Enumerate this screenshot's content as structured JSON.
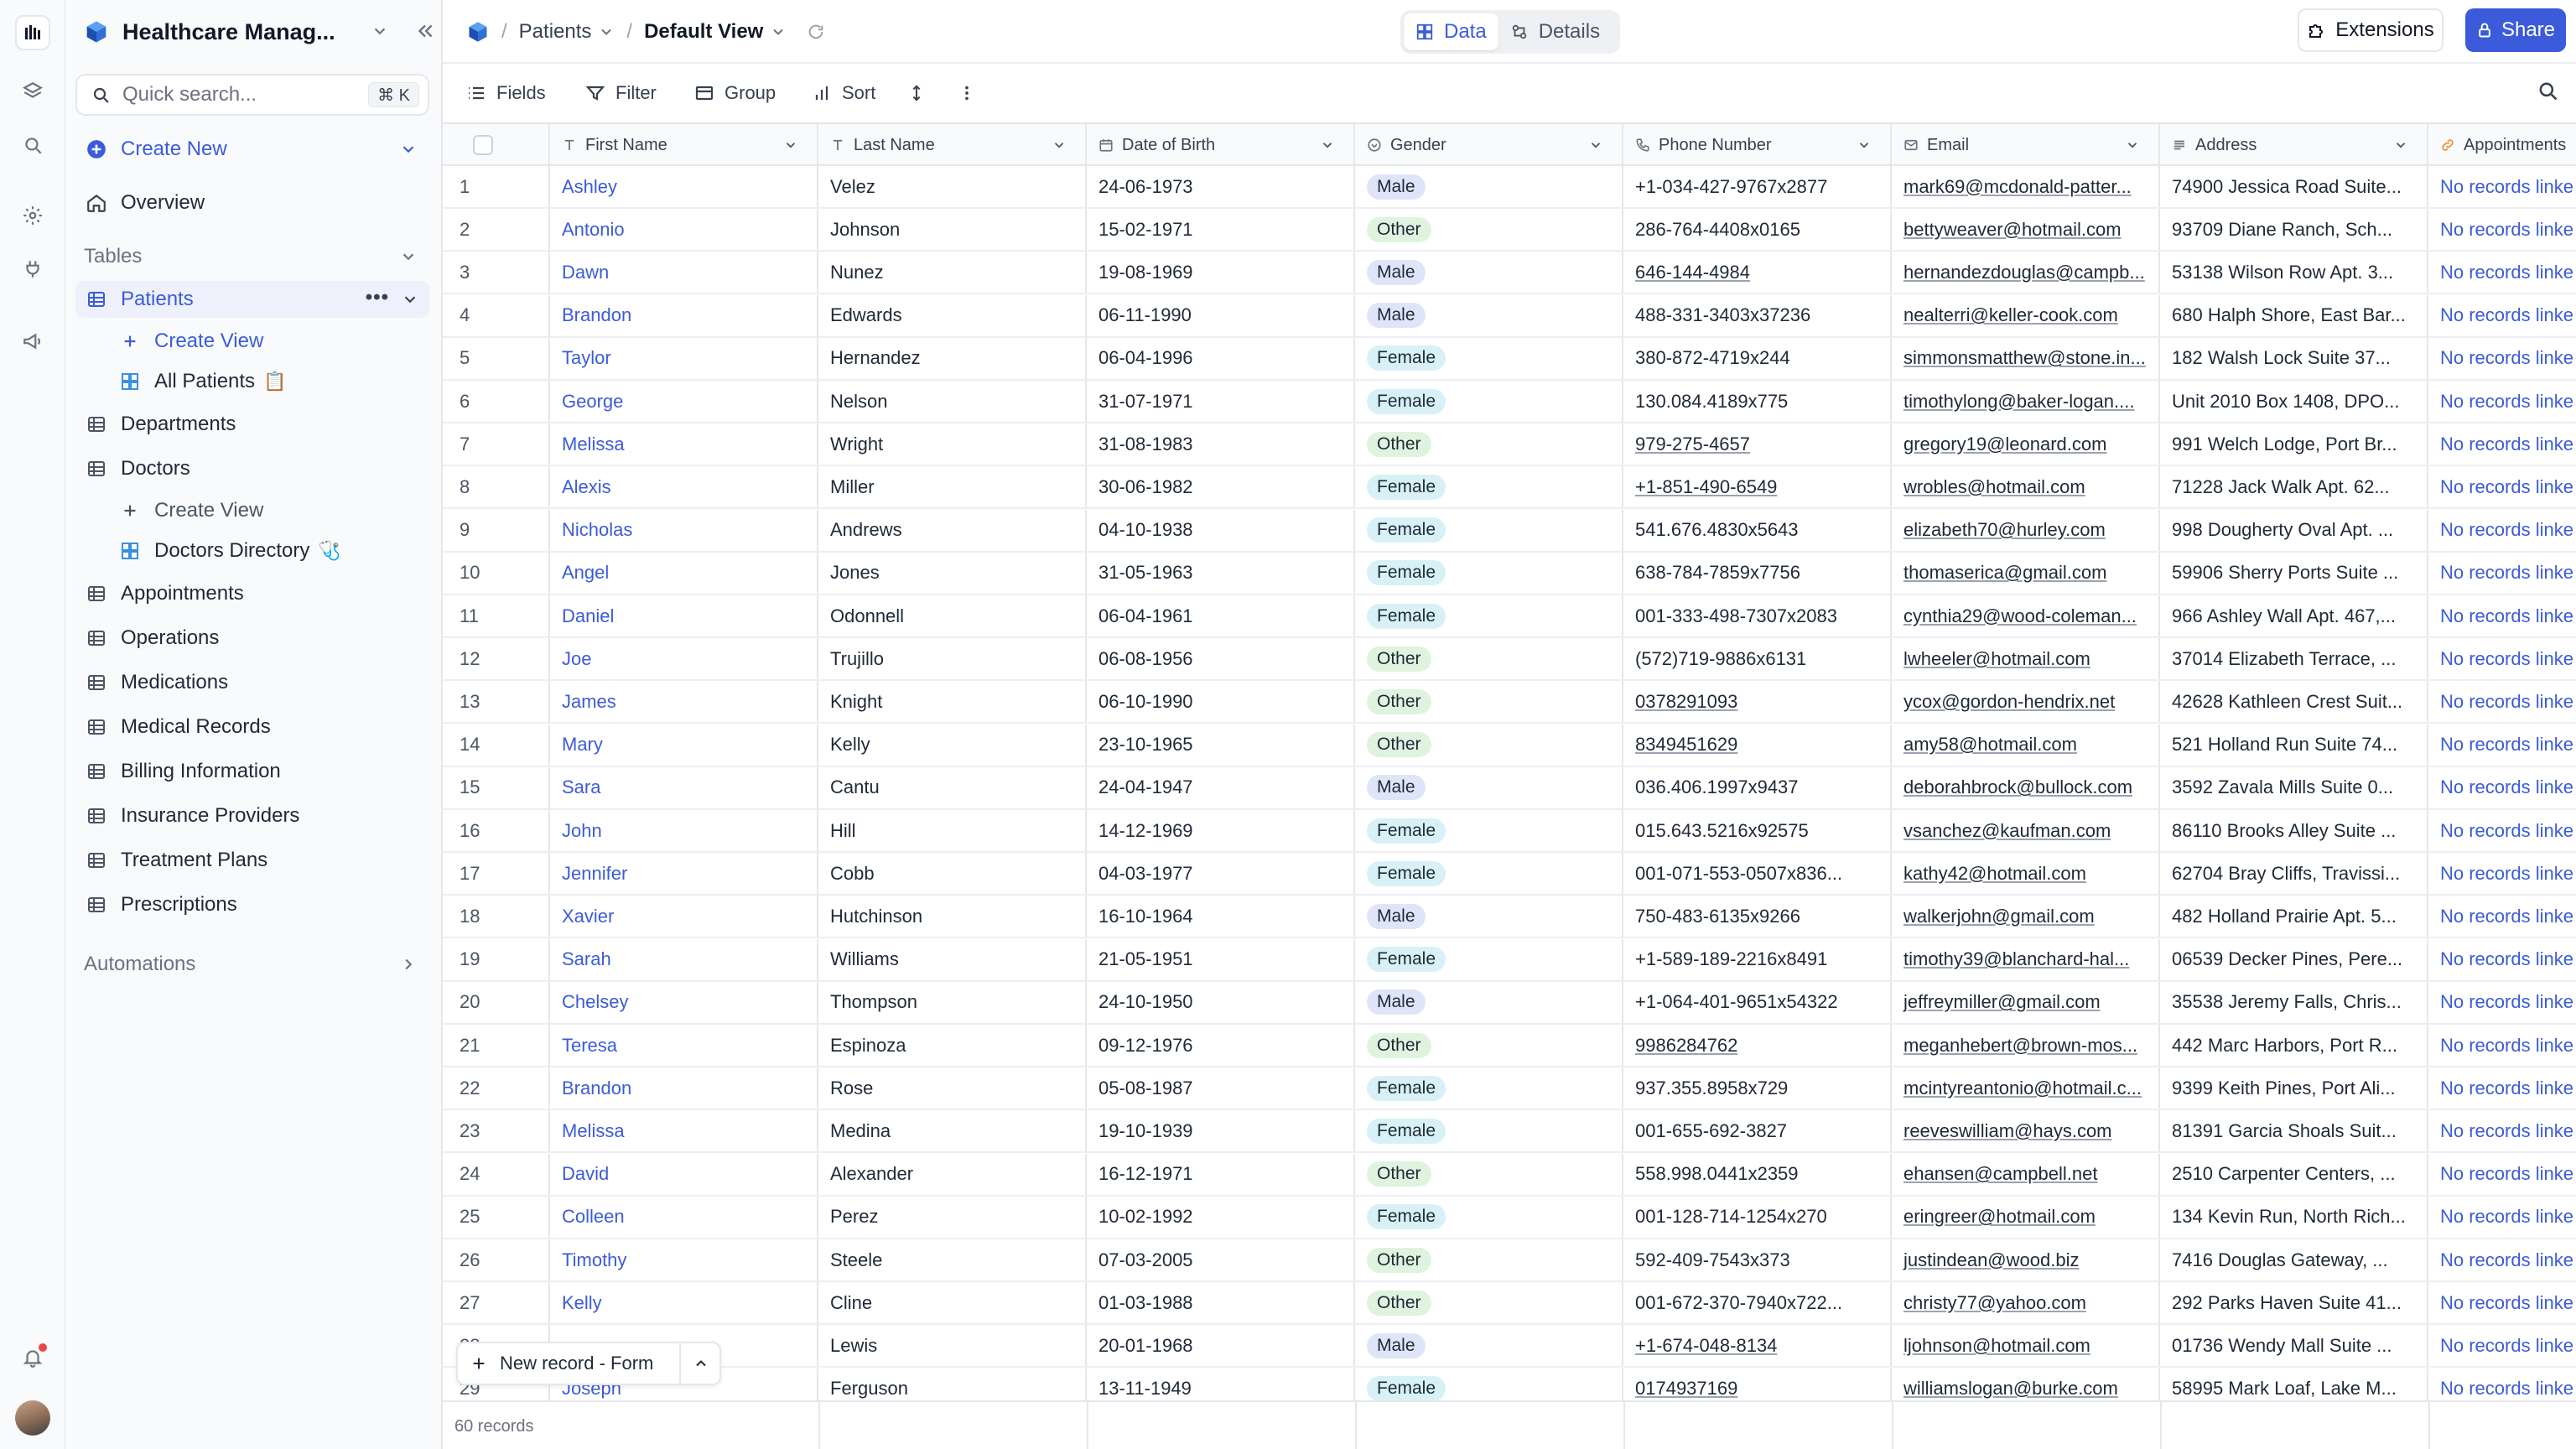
{
  "workspace": {
    "title": "Healthcare Manag..."
  },
  "search": {
    "placeholder": "Quick search...",
    "shortcut": "⌘ K"
  },
  "sidebar": {
    "create_new": "Create New",
    "overview": "Overview",
    "tables_label": "Tables",
    "automations_label": "Automations",
    "items": [
      {
        "label": "Patients",
        "active": true
      },
      {
        "label": "Create View",
        "kind": "create-view"
      },
      {
        "label": "All Patients",
        "kind": "view"
      },
      {
        "label": "Departments"
      },
      {
        "label": "Doctors"
      },
      {
        "label": "Create View",
        "kind": "create-view"
      },
      {
        "label": "Doctors Directory",
        "kind": "view"
      },
      {
        "label": "Appointments"
      },
      {
        "label": "Operations"
      },
      {
        "label": "Medications"
      },
      {
        "label": "Medical Records"
      },
      {
        "label": "Billing Information"
      },
      {
        "label": "Insurance Providers"
      },
      {
        "label": "Treatment Plans"
      },
      {
        "label": "Prescriptions"
      }
    ]
  },
  "topbar": {
    "crumb_table": "Patients",
    "crumb_view": "Default View",
    "tab_data": "Data",
    "tab_details": "Details",
    "extensions": "Extensions",
    "share": "Share"
  },
  "toolbar": {
    "fields": "Fields",
    "filter": "Filter",
    "group": "Group",
    "sort": "Sort"
  },
  "columns": [
    "First Name",
    "Last Name",
    "Date of Birth",
    "Gender",
    "Phone Number",
    "Email",
    "Address",
    "Appointments"
  ],
  "rows": [
    [
      "1",
      "Ashley",
      "Velez",
      "24-06-1973",
      "Male",
      "+1-034-427-9767x2877",
      "mark69@mcdonald-patter...",
      "74900 Jessica Road Suite...",
      "No records linke"
    ],
    [
      "2",
      "Antonio",
      "Johnson",
      "15-02-1971",
      "Other",
      "286-764-4408x0165",
      "bettyweaver@hotmail.com",
      "93709 Diane Ranch, Sch...",
      "No records linke"
    ],
    [
      "3",
      "Dawn",
      "Nunez",
      "19-08-1969",
      "Male",
      "646-144-4984",
      "hernandezdouglas@campb...",
      "53138 Wilson Row Apt. 3...",
      "No records linke"
    ],
    [
      "4",
      "Brandon",
      "Edwards",
      "06-11-1990",
      "Male",
      "488-331-3403x37236",
      "nealterri@keller-cook.com",
      "680 Halph Shore, East Bar...",
      "No records linke"
    ],
    [
      "5",
      "Taylor",
      "Hernandez",
      "06-04-1996",
      "Female",
      "380-872-4719x244",
      "simmonsmatthew@stone.in...",
      "182 Walsh Lock Suite 37...",
      "No records linke"
    ],
    [
      "6",
      "George",
      "Nelson",
      "31-07-1971",
      "Female",
      "130.084.4189x775",
      "timothylong@baker-logan....",
      "Unit 2010 Box 1408, DPO...",
      "No records linke"
    ],
    [
      "7",
      "Melissa",
      "Wright",
      "31-08-1983",
      "Other",
      "979-275-4657",
      "gregory19@leonard.com",
      "991 Welch Lodge, Port Br...",
      "No records linke"
    ],
    [
      "8",
      "Alexis",
      "Miller",
      "30-06-1982",
      "Female",
      "+1-851-490-6549",
      "wrobles@hotmail.com",
      "71228 Jack Walk Apt. 62...",
      "No records linke"
    ],
    [
      "9",
      "Nicholas",
      "Andrews",
      "04-10-1938",
      "Female",
      "541.676.4830x5643",
      "elizabeth70@hurley.com",
      "998 Dougherty Oval Apt. ...",
      "No records linke"
    ],
    [
      "10",
      "Angel",
      "Jones",
      "31-05-1963",
      "Female",
      "638-784-7859x7756",
      "thomaserica@gmail.com",
      "59906 Sherry Ports Suite ...",
      "No records linke"
    ],
    [
      "11",
      "Daniel",
      "Odonnell",
      "06-04-1961",
      "Female",
      "001-333-498-7307x2083",
      "cynthia29@wood-coleman...",
      "966 Ashley Wall Apt. 467,...",
      "No records linke"
    ],
    [
      "12",
      "Joe",
      "Trujillo",
      "06-08-1956",
      "Other",
      "(572)719-9886x6131",
      "lwheeler@hotmail.com",
      "37014 Elizabeth Terrace, ...",
      "No records linke"
    ],
    [
      "13",
      "James",
      "Knight",
      "06-10-1990",
      "Other",
      "0378291093",
      "ycox@gordon-hendrix.net",
      "42628 Kathleen Crest Suit...",
      "No records linke"
    ],
    [
      "14",
      "Mary",
      "Kelly",
      "23-10-1965",
      "Other",
      "8349451629",
      "amy58@hotmail.com",
      "521 Holland Run Suite 74...",
      "No records linke"
    ],
    [
      "15",
      "Sara",
      "Cantu",
      "24-04-1947",
      "Male",
      "036.406.1997x9437",
      "deborahbrock@bullock.com",
      "3592 Zavala Mills Suite 0...",
      "No records linke"
    ],
    [
      "16",
      "John",
      "Hill",
      "14-12-1969",
      "Female",
      "015.643.5216x92575",
      "vsanchez@kaufman.com",
      "86110 Brooks Alley Suite ...",
      "No records linke"
    ],
    [
      "17",
      "Jennifer",
      "Cobb",
      "04-03-1977",
      "Female",
      "001-071-553-0507x836...",
      "kathy42@hotmail.com",
      "62704 Bray Cliffs, Travissi...",
      "No records linke"
    ],
    [
      "18",
      "Xavier",
      "Hutchinson",
      "16-10-1964",
      "Male",
      "750-483-6135x9266",
      "walkerjohn@gmail.com",
      "482 Holland Prairie Apt. 5...",
      "No records linke"
    ],
    [
      "19",
      "Sarah",
      "Williams",
      "21-05-1951",
      "Female",
      "+1-589-189-2216x8491",
      "timothy39@blanchard-hal...",
      "06539 Decker Pines, Pere...",
      "No records linke"
    ],
    [
      "20",
      "Chelsey",
      "Thompson",
      "24-10-1950",
      "Male",
      "+1-064-401-9651x54322",
      "jeffreymiller@gmail.com",
      "35538 Jeremy Falls, Chris...",
      "No records linke"
    ],
    [
      "21",
      "Teresa",
      "Espinoza",
      "09-12-1976",
      "Other",
      "9986284762",
      "meganhebert@brown-mos...",
      "442 Marc Harbors, Port R...",
      "No records linke"
    ],
    [
      "22",
      "Brandon",
      "Rose",
      "05-08-1987",
      "Female",
      "937.355.8958x729",
      "mcintyreantonio@hotmail.c...",
      "9399 Keith Pines, Port Ali...",
      "No records linke"
    ],
    [
      "23",
      "Melissa",
      "Medina",
      "19-10-1939",
      "Female",
      "001-655-692-3827",
      "reeveswilliam@hays.com",
      "81391 Garcia Shoals Suit...",
      "No records linke"
    ],
    [
      "24",
      "David",
      "Alexander",
      "16-12-1971",
      "Other",
      "558.998.0441x2359",
      "ehansen@campbell.net",
      "2510 Carpenter Centers, ...",
      "No records linke"
    ],
    [
      "25",
      "Colleen",
      "Perez",
      "10-02-1992",
      "Female",
      "001-128-714-1254x270",
      "eringreer@hotmail.com",
      "134 Kevin Run, North Rich...",
      "No records linke"
    ],
    [
      "26",
      "Timothy",
      "Steele",
      "07-03-2005",
      "Other",
      "592-409-7543x373",
      "justindean@wood.biz",
      "7416 Douglas Gateway, ...",
      "No records linke"
    ],
    [
      "27",
      "Kelly",
      "Cline",
      "01-03-1988",
      "Other",
      "001-672-370-7940x722...",
      "christy77@yahoo.com",
      "292 Parks Haven Suite 41...",
      "No records linke"
    ],
    [
      "28",
      "",
      "Lewis",
      "20-01-1968",
      "Male",
      "+1-674-048-8134",
      "ljohnson@hotmail.com",
      "01736 Wendy Mall Suite ...",
      "No records linke"
    ],
    [
      "29",
      "Joseph",
      "Ferguson",
      "13-11-1949",
      "Female",
      "0174937169",
      "williamslogan@burke.com",
      "58995 Mark Loaf, Lake M...",
      "No records linke"
    ]
  ],
  "new_record": "New record - Form",
  "footer": {
    "count": "60 records"
  },
  "colors": {
    "accent": "#3b5bdb",
    "male": "#dfe5f8",
    "female": "#d8f1f6",
    "other": "#dff3df",
    "link": "#3b5bdb"
  }
}
